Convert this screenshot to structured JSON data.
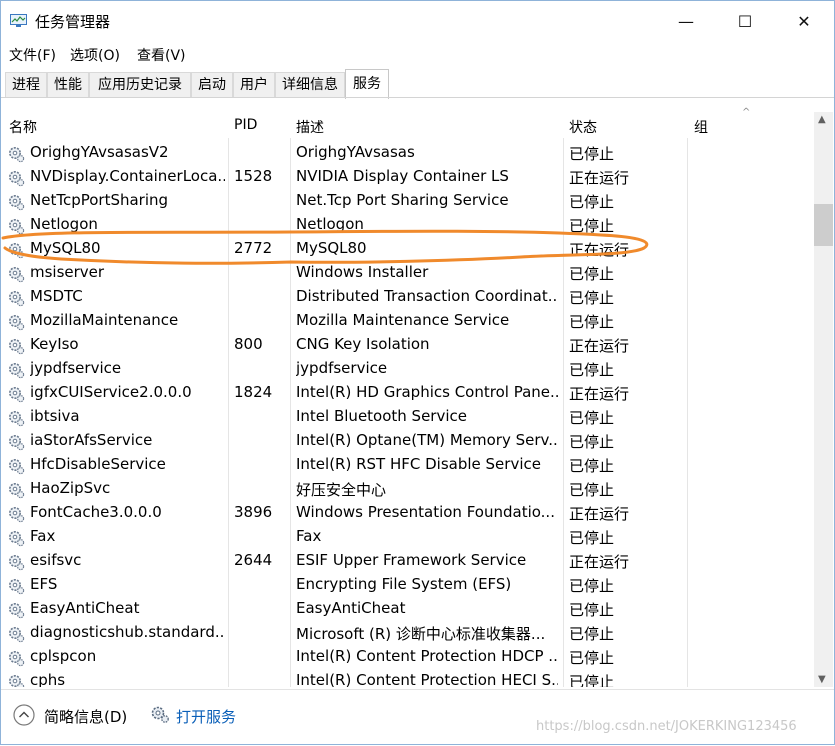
{
  "window": {
    "title": "任务管理器",
    "minimize": "—",
    "maximize": "☐",
    "close": "✕"
  },
  "menu": [
    "文件(F)",
    "选项(O)",
    "查看(V)"
  ],
  "tabs": [
    "进程",
    "性能",
    "应用历史记录",
    "启动",
    "用户",
    "详细信息",
    "服务"
  ],
  "active_tab": "服务",
  "table": {
    "columns": [
      "名称",
      "PID",
      "描述",
      "状态",
      "组"
    ],
    "rows": [
      {
        "name": "OrighgYAvsasasV2",
        "pid": "",
        "desc": "OrighgYAvsasas",
        "status": "已停止"
      },
      {
        "name": "NVDisplay.ContainerLoca...",
        "pid": "1528",
        "desc": "NVIDIA Display Container LS",
        "status": "正在运行"
      },
      {
        "name": "NetTcpPortSharing",
        "pid": "",
        "desc": "Net.Tcp Port Sharing Service",
        "status": "已停止"
      },
      {
        "name": "Netlogon",
        "pid": "",
        "desc": "Netlogon",
        "status": "已停止"
      },
      {
        "name": "MySQL80",
        "pid": "2772",
        "desc": "MySQL80",
        "status": "正在运行"
      },
      {
        "name": "msiserver",
        "pid": "",
        "desc": "Windows Installer",
        "status": "已停止"
      },
      {
        "name": "MSDTC",
        "pid": "",
        "desc": "Distributed Transaction Coordinat...",
        "status": "已停止"
      },
      {
        "name": "MozillaMaintenance",
        "pid": "",
        "desc": "Mozilla Maintenance Service",
        "status": "已停止"
      },
      {
        "name": "KeyIso",
        "pid": "800",
        "desc": "CNG Key Isolation",
        "status": "正在运行"
      },
      {
        "name": "jypdfservice",
        "pid": "",
        "desc": "jypdfservice",
        "status": "已停止"
      },
      {
        "name": "igfxCUIService2.0.0.0",
        "pid": "1824",
        "desc": "Intel(R) HD Graphics Control Pane...",
        "status": "正在运行"
      },
      {
        "name": "ibtsiva",
        "pid": "",
        "desc": "Intel Bluetooth Service",
        "status": "已停止"
      },
      {
        "name": "iaStorAfsService",
        "pid": "",
        "desc": "Intel(R) Optane(TM) Memory Serv...",
        "status": "已停止"
      },
      {
        "name": "HfcDisableService",
        "pid": "",
        "desc": "Intel(R) RST HFC Disable Service",
        "status": "已停止"
      },
      {
        "name": "HaoZipSvc",
        "pid": "",
        "desc": "好压安全中心",
        "status": "已停止"
      },
      {
        "name": "FontCache3.0.0.0",
        "pid": "3896",
        "desc": "Windows Presentation Foundatio...",
        "status": "正在运行"
      },
      {
        "name": "Fax",
        "pid": "",
        "desc": "Fax",
        "status": "已停止"
      },
      {
        "name": "esifsvc",
        "pid": "2644",
        "desc": "ESIF Upper Framework Service",
        "status": "正在运行"
      },
      {
        "name": "EFS",
        "pid": "",
        "desc": "Encrypting File System (EFS)",
        "status": "已停止"
      },
      {
        "name": "EasyAntiCheat",
        "pid": "",
        "desc": "EasyAntiCheat",
        "status": "已停止"
      },
      {
        "name": "diagnosticshub.standard...",
        "pid": "",
        "desc": "Microsoft (R) 诊断中心标准收集器...",
        "status": "已停止"
      },
      {
        "name": "cplspcon",
        "pid": "",
        "desc": "Intel(R) Content Protection HDCP ...",
        "status": "已停止"
      },
      {
        "name": "cphs",
        "pid": "",
        "desc": "Intel(R) Content Protection HECI S...",
        "status": "已停止"
      }
    ]
  },
  "footer": {
    "fewer_details": "简略信息(D)",
    "open_services": "打开服务"
  },
  "watermark": "https://blog.csdn.net/JOKERKING123456",
  "colors": {
    "annotation": "#f08a2c",
    "link": "#0a5fb8",
    "window_border": "#8fb3d9"
  }
}
